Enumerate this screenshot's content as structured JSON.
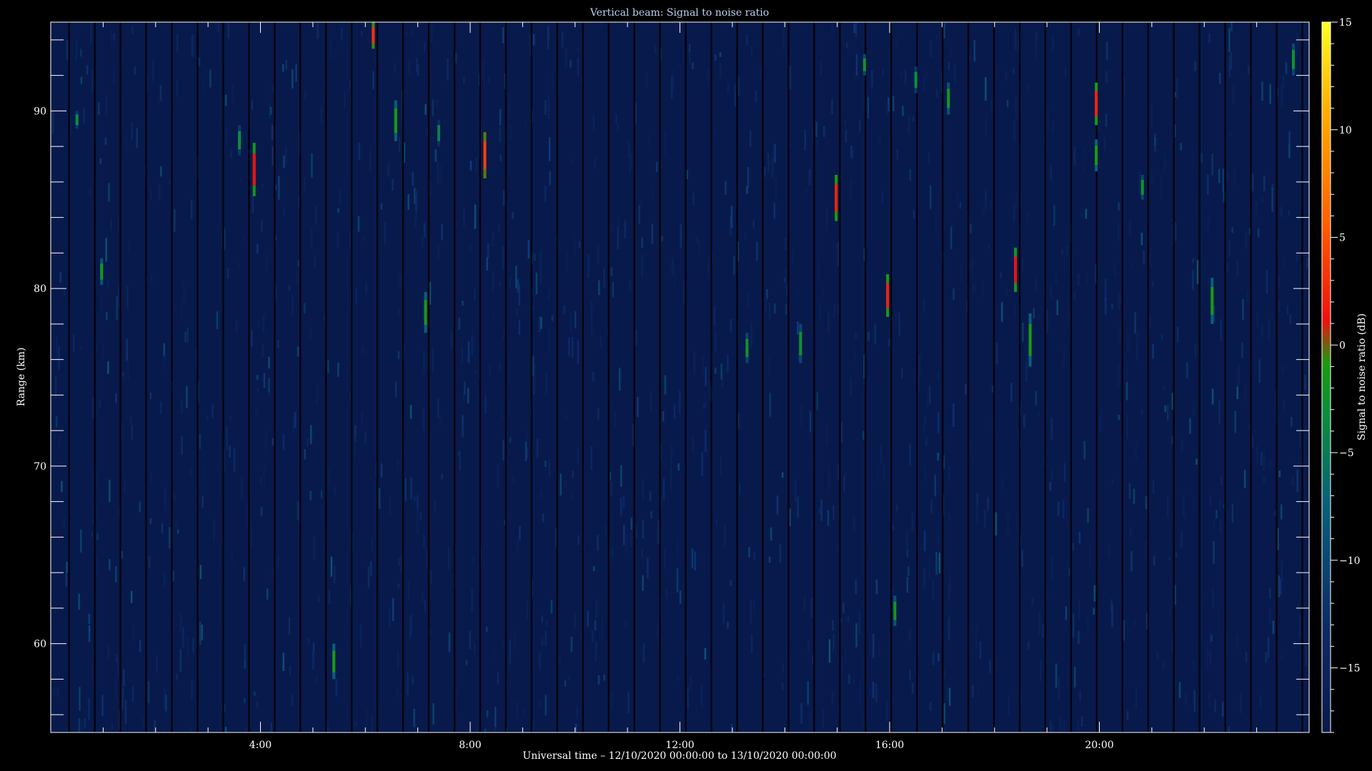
{
  "chart_data": {
    "type": "heatmap",
    "title": "Vertical beam: Signal to noise ratio",
    "xlabel": "Universal time – 12/10/2020 00:00:00 to 13/10/2020 00:00:00",
    "ylabel": "Range (km)",
    "colorbar_label": "Signal to noise ratio (dB)",
    "x_unit": "hours UT",
    "xlim": [
      0,
      24
    ],
    "ylim": [
      55,
      95
    ],
    "x_ticks": [
      4,
      8,
      12,
      16,
      20
    ],
    "x_tick_labels": [
      "4:00",
      "8:00",
      "12:00",
      "16:00",
      "20:00"
    ],
    "y_ticks": [
      60,
      70,
      80,
      90
    ],
    "y_tick_labels": [
      "60",
      "70",
      "80",
      "90"
    ],
    "colorbar_range": [
      -18,
      15
    ],
    "colorbar_ticks": [
      -15,
      -10,
      -5,
      0,
      5,
      10,
      15
    ],
    "colorbar_tick_labels": [
      "−15",
      "−10",
      "−5",
      "0",
      "5",
      "10",
      "15"
    ],
    "background_snr": -16,
    "echoes": [
      {
        "t": 0.5,
        "r0": 89.0,
        "r1": 90.0,
        "snr": -8
      },
      {
        "t": 0.97,
        "r0": 80.2,
        "r1": 81.7,
        "snr": -6
      },
      {
        "t": 3.6,
        "r0": 87.5,
        "r1": 89.2,
        "snr": -8
      },
      {
        "t": 3.88,
        "r0": 85.2,
        "r1": 88.2,
        "snr": 0
      },
      {
        "t": 5.4,
        "r0": 58.0,
        "r1": 60.0,
        "snr": -5
      },
      {
        "t": 6.15,
        "r0": 93.5,
        "r1": 95.0,
        "snr": 2
      },
      {
        "t": 6.58,
        "r0": 88.3,
        "r1": 90.6,
        "snr": -5
      },
      {
        "t": 7.15,
        "r0": 77.5,
        "r1": 79.8,
        "snr": -5
      },
      {
        "t": 7.4,
        "r0": 88.0,
        "r1": 89.5,
        "snr": -9
      },
      {
        "t": 8.28,
        "r0": 86.2,
        "r1": 88.8,
        "snr": 3
      },
      {
        "t": 13.28,
        "r0": 75.8,
        "r1": 77.5,
        "snr": -7
      },
      {
        "t": 14.3,
        "r0": 75.8,
        "r1": 78.0,
        "snr": -7
      },
      {
        "t": 14.98,
        "r0": 83.8,
        "r1": 86.4,
        "snr": 1
      },
      {
        "t": 15.52,
        "r0": 92.0,
        "r1": 93.2,
        "snr": -7
      },
      {
        "t": 15.96,
        "r0": 78.4,
        "r1": 80.8,
        "snr": 1
      },
      {
        "t": 16.1,
        "r0": 61.0,
        "r1": 62.7,
        "snr": -6
      },
      {
        "t": 16.5,
        "r0": 91.0,
        "r1": 92.5,
        "snr": -8
      },
      {
        "t": 17.12,
        "r0": 89.8,
        "r1": 91.6,
        "snr": -6
      },
      {
        "t": 18.4,
        "r0": 79.8,
        "r1": 82.3,
        "snr": 0
      },
      {
        "t": 18.68,
        "r0": 75.6,
        "r1": 78.6,
        "snr": -5
      },
      {
        "t": 19.94,
        "r0": 89.2,
        "r1": 91.6,
        "snr": 1
      },
      {
        "t": 19.94,
        "r0": 86.6,
        "r1": 88.4,
        "snr": -5
      },
      {
        "t": 20.82,
        "r0": 85.0,
        "r1": 86.4,
        "snr": -7
      },
      {
        "t": 22.15,
        "r0": 78.0,
        "r1": 80.6,
        "snr": -5
      },
      {
        "t": 23.7,
        "r0": 92.0,
        "r1": 93.8,
        "snr": -7
      }
    ]
  }
}
